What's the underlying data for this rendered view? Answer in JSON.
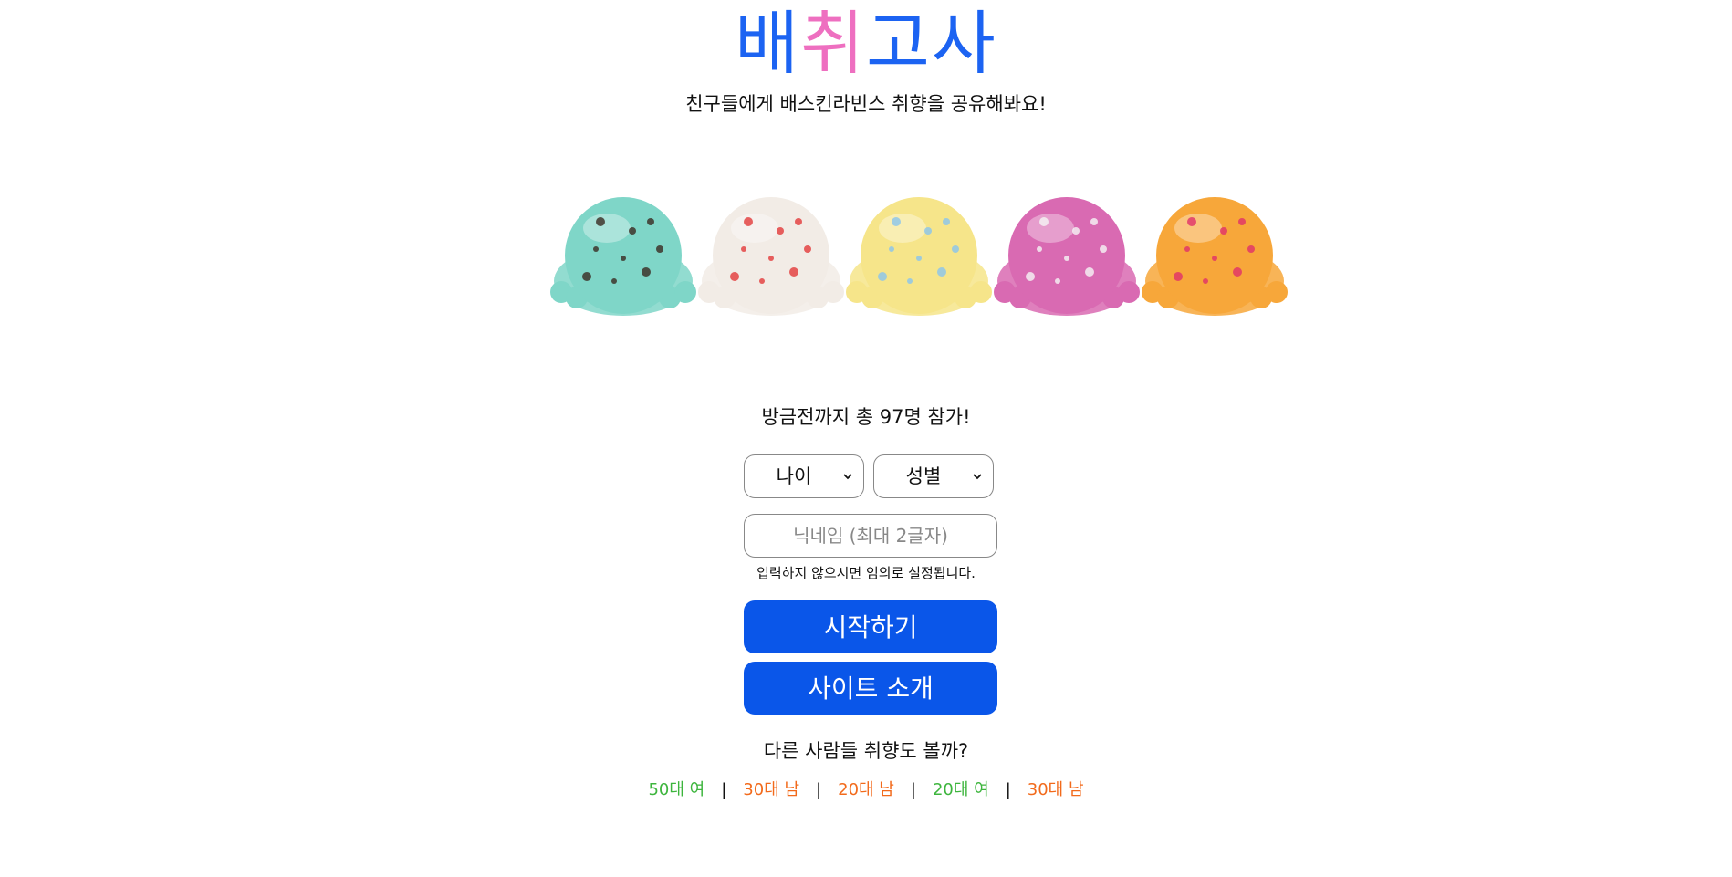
{
  "logo": {
    "chars": [
      "배",
      "취",
      "고",
      "사"
    ],
    "colors": [
      "#1c63f2",
      "#ee6fc0",
      "#1c63f2",
      "#1c63f2"
    ]
  },
  "subtitle": "친구들에게 배스킨라빈스 취향을 공유해봐요!",
  "scoops": [
    {
      "icon": "mint-choco-scoop-icon",
      "base": "#7fd6c8",
      "accent": "#3a2a22"
    },
    {
      "icon": "cherry-jubilee-scoop-icon",
      "base": "#f2ece6",
      "accent": "#e23a3a"
    },
    {
      "icon": "rainbow-sherbet-scoop-icon",
      "base": "#f6e58a",
      "accent": "#8ac4ee"
    },
    {
      "icon": "cotton-candy-scoop-icon",
      "base": "#d96ab2",
      "accent": "#f5f5f5"
    },
    {
      "icon": "strawberry-orange-scoop-icon",
      "base": "#f7a73a",
      "accent": "#e0316a"
    }
  ],
  "participants": "방금전까지 총 97명 참가!",
  "form": {
    "age_label": "나이",
    "gender_label": "성별",
    "nickname_placeholder": "닉네임 (최대 2글자)",
    "nickname_hint": "입력하지 않으시면 임의로 설정됩니다.",
    "start_label": "시작하기",
    "about_label": "사이트 소개"
  },
  "others": {
    "title": "다른 사람들 취향도 볼까?",
    "separator": "|",
    "links": [
      {
        "label": "50대 여",
        "color": "#3db53d"
      },
      {
        "label": "30대 남",
        "color": "#f26a1b"
      },
      {
        "label": "20대 남",
        "color": "#f26a1b"
      },
      {
        "label": "20대 여",
        "color": "#3db53d"
      },
      {
        "label": "30대 남",
        "color": "#f26a1b"
      }
    ]
  }
}
